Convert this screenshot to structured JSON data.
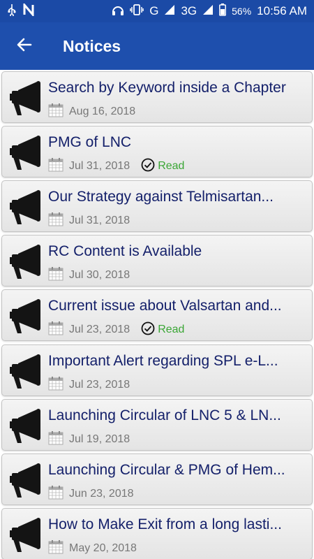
{
  "status_bar": {
    "network": "G",
    "network2": "3G",
    "battery": "56%",
    "time": "10:56 AM"
  },
  "header": {
    "title": "Notices"
  },
  "notices": [
    {
      "title": "Search by Keyword inside a Chapter",
      "date": "Aug 16, 2018",
      "read": false
    },
    {
      "title": "PMG of LNC",
      "date": "Jul 31, 2018",
      "read": true
    },
    {
      "title": "Our Strategy against Telmisartan...",
      "date": "Jul 31, 2018",
      "read": false
    },
    {
      "title": "RC Content is Available",
      "date": "Jul 30, 2018",
      "read": false
    },
    {
      "title": "Current issue about Valsartan and...",
      "date": "Jul 23, 2018",
      "read": true
    },
    {
      "title": "Important Alert regarding SPL e-L...",
      "date": "Jul 23, 2018",
      "read": false
    },
    {
      "title": "Launching Circular of LNC 5 & LN...",
      "date": "Jul 19, 2018",
      "read": false
    },
    {
      "title": "Launching Circular & PMG of Hem...",
      "date": "Jun 23, 2018",
      "read": false
    },
    {
      "title": "How to Make Exit from a long lasti...",
      "date": "May 20, 2018",
      "read": false
    }
  ],
  "read_label": "Read",
  "colors": {
    "app_bar": "#1e4fad",
    "title_text": "#14206a",
    "read_green": "#3aa635"
  }
}
